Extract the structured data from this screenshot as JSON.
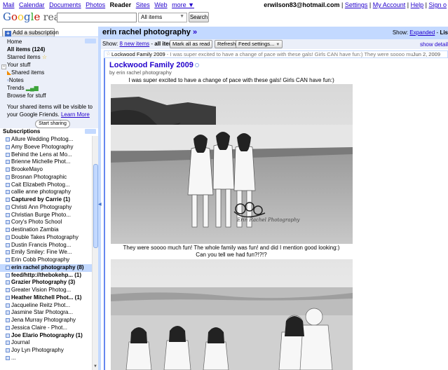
{
  "topnav": {
    "links": [
      "Mail",
      "Calendar",
      "Documents",
      "Photos"
    ],
    "current": "Reader",
    "links2": [
      "Sites",
      "Web"
    ],
    "more": "more ▼",
    "email": "erwilson83@hotmail.com",
    "settings": "Settings",
    "account": "My Account",
    "help": "Help",
    "signout": "Sign o"
  },
  "logo": {
    "g1": "G",
    "g2": "o",
    "g3": "o",
    "g4": "g",
    "g5": "l",
    "g6": "e",
    "reader": " reader"
  },
  "search": {
    "value": "",
    "scope": "All items",
    "button": "Search"
  },
  "sidebar": {
    "add_subscription": "Add a subscription",
    "home": "Home",
    "all_items": "All items (124)",
    "starred": "Starred items",
    "your_stuff": "Your stuff",
    "shared_items": "Shared items",
    "notes": "Notes",
    "trends": "Trends",
    "browse": "Browse for stuff",
    "share_note": "Your shared items will be visible to your Google Friends.",
    "learn_more": "Learn More",
    "start_sharing": "Start sharing",
    "subscriptions_title": "Subscriptions",
    "subscriptions": [
      {
        "label": "Allure Wedding Photog...",
        "bold": false
      },
      {
        "label": "Amy Boeve Photography",
        "bold": false
      },
      {
        "label": "Behind the Lens at Mo...",
        "bold": false
      },
      {
        "label": "Brienne Michelle Phot...",
        "bold": false
      },
      {
        "label": "BrookeMayo",
        "bold": false
      },
      {
        "label": "Brosnan Photographic",
        "bold": false
      },
      {
        "label": "Cait Elizabeth Photog...",
        "bold": false
      },
      {
        "label": "callie anne photography",
        "bold": false
      },
      {
        "label": "Captured by Carrie (1)",
        "bold": true
      },
      {
        "label": "Christi Ann Photography",
        "bold": false
      },
      {
        "label": "Christian Burge Photo...",
        "bold": false
      },
      {
        "label": "Cory's Photo School",
        "bold": false
      },
      {
        "label": "destination Zambia",
        "bold": false
      },
      {
        "label": "Double Takes Photography",
        "bold": false
      },
      {
        "label": "Dustin Francis Photog...",
        "bold": false
      },
      {
        "label": "Emily Smiley: Fine We...",
        "bold": false
      },
      {
        "label": "Erin Cobb Photography",
        "bold": false
      },
      {
        "label": "erin rachel photography (8)",
        "bold": true,
        "selected": true
      },
      {
        "label": "feed/http://thebokehp... (1)",
        "bold": true
      },
      {
        "label": "Grazier Photography (3)",
        "bold": true
      },
      {
        "label": "Greater Vision Photog...",
        "bold": false
      },
      {
        "label": "Heather Mitchell Phot... (1)",
        "bold": true
      },
      {
        "label": "Jacqueline Reitz Phot...",
        "bold": false
      },
      {
        "label": "Jasmine Star Photogra...",
        "bold": false
      },
      {
        "label": "Jena Murray Photography",
        "bold": false
      },
      {
        "label": "Jessica Claire - Phot...",
        "bold": false
      },
      {
        "label": "Joe Elario Photography (1)",
        "bold": true
      },
      {
        "label": "Journal",
        "bold": false
      },
      {
        "label": "Joy Lyn Photography",
        "bold": false
      },
      {
        "label": "...",
        "bold": false
      }
    ]
  },
  "main": {
    "feed_title": "erin rachel photography",
    "feed_title_arrow": " »",
    "show_label": "Show: ",
    "expanded": "Expanded",
    "list_sep": " - ",
    "list": "Lis",
    "toolbar": {
      "show": "Show: ",
      "new_items": "8 new items",
      "sep": " - ",
      "all_items": "all items",
      "mark_all": "Mark all as read",
      "refresh": "Refresh",
      "feed_settings": "Feed settings...",
      "show_details": "show detail"
    },
    "item": {
      "title": "Lockwood Family 2009",
      "snippet": " - I was super excited to have a change of pace with these gals! Girls CAN have fun:) They were soooo much",
      "date": "Jun 2, 2009"
    },
    "article": {
      "title": "Lockwood Family 2009",
      "by": "by erin rachel photography",
      "caption1": "I was super excited to have a change of pace with these gals! Girls CAN have fun:)",
      "caption2": "They were soooo much fun! The whole family was fun! and did I mention good looking:)",
      "caption3": "Can you tell we had fun?!?!?",
      "watermark": "Erin Rachel Photography"
    }
  }
}
